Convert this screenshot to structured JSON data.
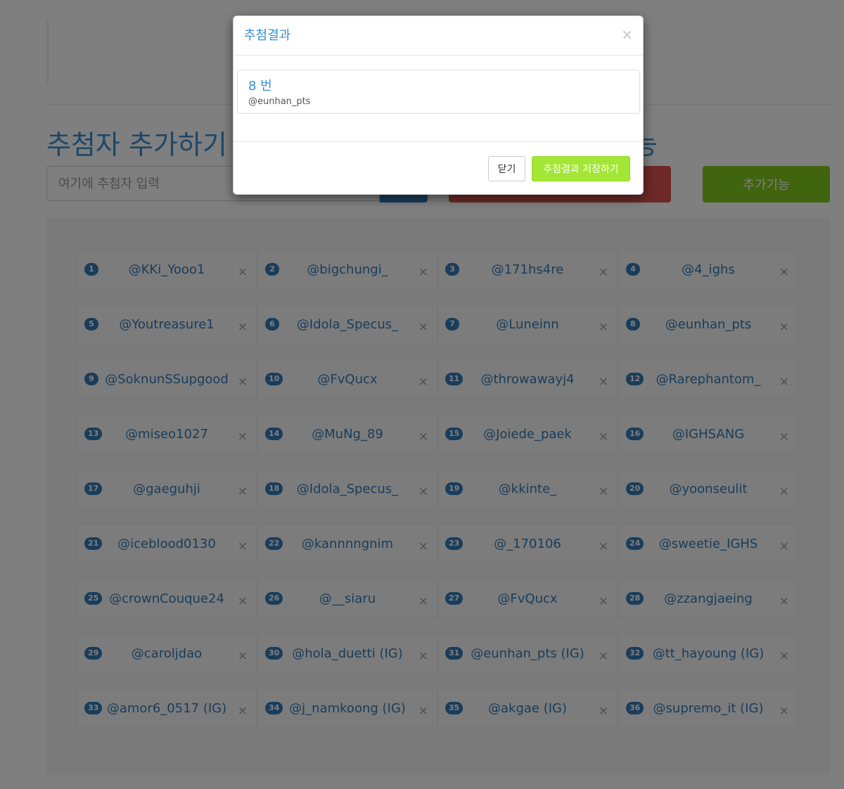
{
  "page": {
    "title": "추첨자 추가하기",
    "title_right_fragment": "능",
    "input_placeholder": "여기에 추첨자 입력",
    "extra_button": "추가기능"
  },
  "entries": [
    {
      "num": "1",
      "name": "@KKi_Yooo1"
    },
    {
      "num": "2",
      "name": "@bigchungi_"
    },
    {
      "num": "3",
      "name": "@171hs4re"
    },
    {
      "num": "4",
      "name": "@4_ighs"
    },
    {
      "num": "5",
      "name": "@Youtreasure1"
    },
    {
      "num": "6",
      "name": "@Idola_Specus_"
    },
    {
      "num": "7",
      "name": "@Luneinn"
    },
    {
      "num": "8",
      "name": "@eunhan_pts"
    },
    {
      "num": "9",
      "name": "@SoknunSSupgood"
    },
    {
      "num": "10",
      "name": "@FvQucx"
    },
    {
      "num": "11",
      "name": "@throwawayj4"
    },
    {
      "num": "12",
      "name": "@Rarephantom_"
    },
    {
      "num": "13",
      "name": "@miseo1027"
    },
    {
      "num": "14",
      "name": "@MuNg_89"
    },
    {
      "num": "15",
      "name": "@Joiede_paek"
    },
    {
      "num": "16",
      "name": "@IGHSANG"
    },
    {
      "num": "17",
      "name": "@gaeguhji"
    },
    {
      "num": "18",
      "name": "@Idola_Specus_"
    },
    {
      "num": "19",
      "name": "@kkinte_"
    },
    {
      "num": "20",
      "name": "@yoonseulit"
    },
    {
      "num": "21",
      "name": "@iceblood0130"
    },
    {
      "num": "22",
      "name": "@kannnngnim"
    },
    {
      "num": "23",
      "name": "@_170106"
    },
    {
      "num": "24",
      "name": "@sweetie_IGHS"
    },
    {
      "num": "25",
      "name": "@crownCouque24"
    },
    {
      "num": "26",
      "name": "@__siaru"
    },
    {
      "num": "27",
      "name": "@FvQucx"
    },
    {
      "num": "28",
      "name": "@zzangjaeing"
    },
    {
      "num": "29",
      "name": "@caroljdao"
    },
    {
      "num": "30",
      "name": "@hola_duetti (IG)"
    },
    {
      "num": "31",
      "name": "@eunhan_pts (IG)"
    },
    {
      "num": "32",
      "name": "@tt_hayoung (IG)"
    },
    {
      "num": "33",
      "name": "@amor6_0517 (IG)"
    },
    {
      "num": "34",
      "name": "@j_namkoong (IG)"
    },
    {
      "num": "35",
      "name": "@akgae (IG)"
    },
    {
      "num": "36",
      "name": "@supremo_it (IG)"
    }
  ],
  "remove_glyph": "×",
  "modal": {
    "title": "추첨결과",
    "close_glyph": "×",
    "result_number": "8 번",
    "result_user": "@eunhan_pts",
    "close_button": "닫기",
    "save_button": "추첨결과 저장하기"
  },
  "colors": {
    "accent_blue": "#337ab7",
    "title_blue": "#3a8fd0",
    "danger_red": "#d9534f",
    "extra_green": "#82c91e",
    "save_green": "#a3e635"
  }
}
